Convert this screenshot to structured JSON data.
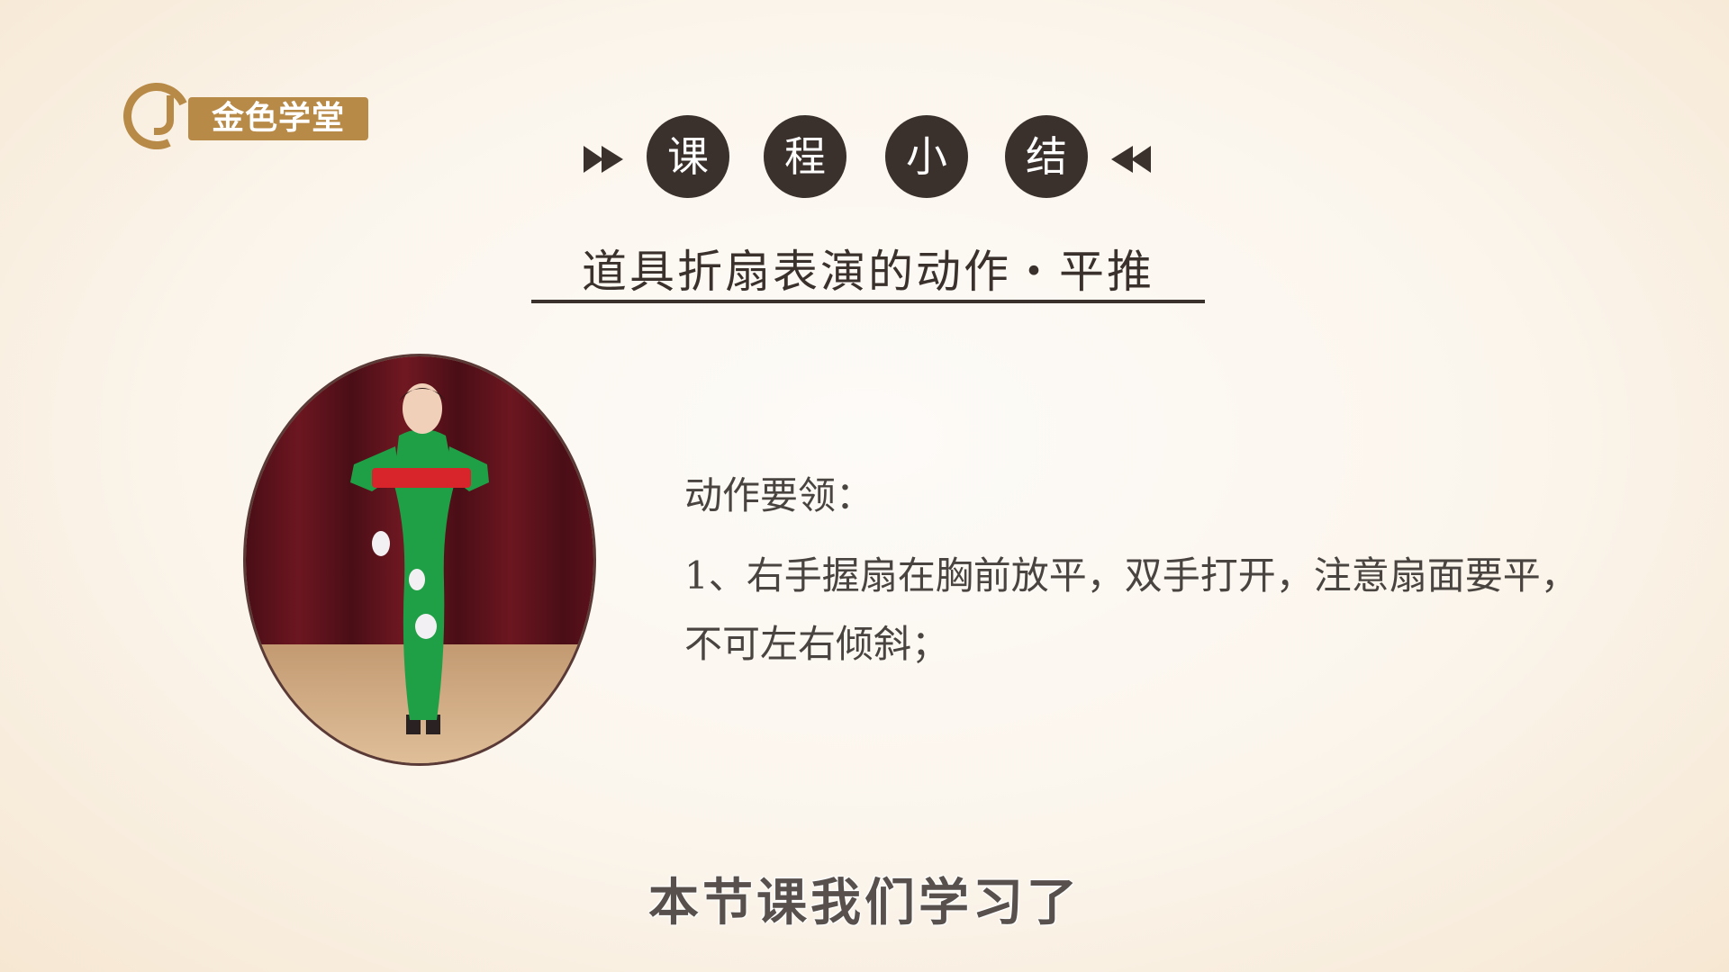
{
  "logo": {
    "text": "金色学堂",
    "color": "#b88a48"
  },
  "header": {
    "chars": [
      "课",
      "程",
      "小",
      "结"
    ],
    "arrow_icons": [
      "fast-forward-icon",
      "fast-rewind-icon"
    ],
    "bubble_color": "#3a302c"
  },
  "subtitle": "道具折扇表演的动作・平推",
  "content": {
    "heading": "动作要领：",
    "lines": [
      "1、右手握扇在胸前放平，双手打开，注意扇面要平，",
      "不可左右倾斜；"
    ]
  },
  "caption": "本节课我们学习了"
}
